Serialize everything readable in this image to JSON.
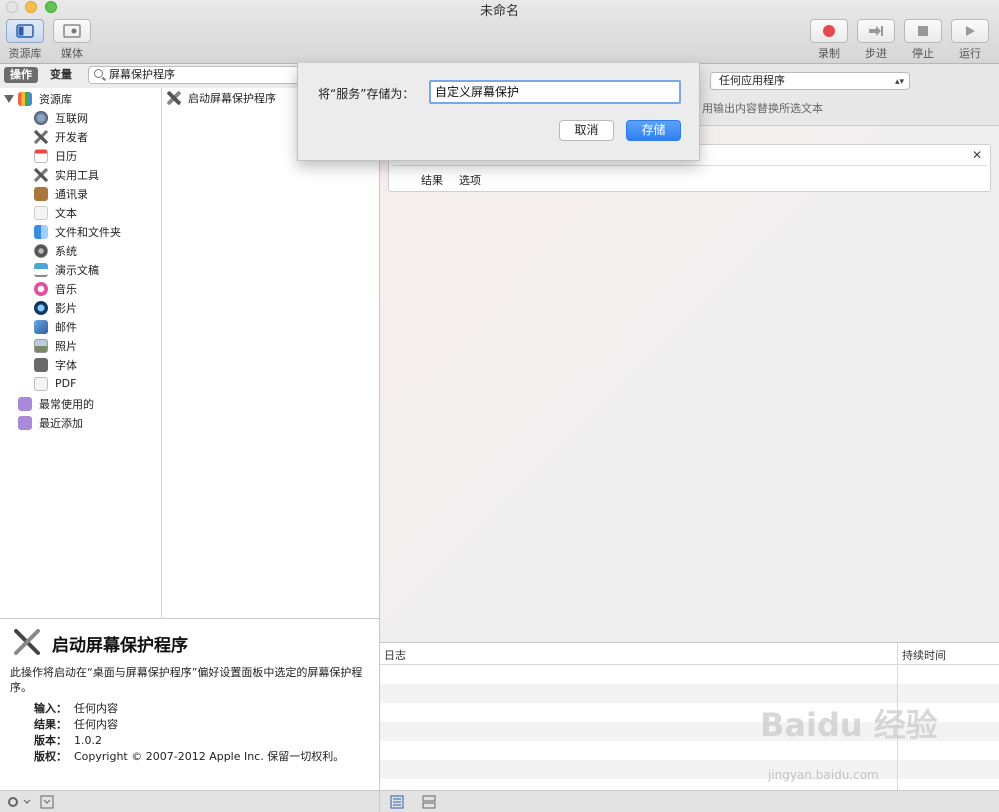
{
  "window": {
    "title": "未命名"
  },
  "toolbar": {
    "library": "资源库",
    "media": "媒体",
    "record": "录制",
    "step": "步进",
    "stop": "停止",
    "run": "运行"
  },
  "tabs": {
    "actions": "操作",
    "variables": "变量"
  },
  "search": {
    "value": "屏幕保护程序"
  },
  "library": {
    "root": "资源库",
    "items": [
      "互联网",
      "开发者",
      "日历",
      "实用工具",
      "通讯录",
      "文本",
      "文件和文件夹",
      "系统",
      "演示文稿",
      "音乐",
      "影片",
      "邮件",
      "照片",
      "字体",
      "PDF"
    ],
    "smart": [
      "最常使用的",
      "最近添加"
    ]
  },
  "actions_list": [
    "启动屏幕保护程序"
  ],
  "description": {
    "title": "启动屏幕保护程序",
    "text": "此操作将启动在“桌面与屏幕保护程序”偏好设置面板中选定的屏幕保护程序。",
    "input_key": "输入：",
    "input_val": "任何内容",
    "result_key": "结果：",
    "result_val": "任何内容",
    "version_key": "版本：",
    "version_val": "1.0.2",
    "copyright_key": "版权：",
    "copyright_val": "Copyright © 2007-2012 Apple Inc. 保留一切权利。"
  },
  "service": {
    "app_select": "任何应用程序",
    "replace_text": "用输出内容替换所选文本"
  },
  "card": {
    "tab_results": "结果",
    "tab_options": "选项"
  },
  "log": {
    "col_log": "日志",
    "col_duration": "持续时间"
  },
  "dialog": {
    "label": "将“服务”存储为：",
    "value": "自定义屏幕保护",
    "cancel": "取消",
    "save": "存储"
  },
  "watermark": {
    "text": "Baidu 经验",
    "sub": "jingyan.baidu.com"
  },
  "colors": {
    "accent": "#2d7ff3",
    "record": "#e5484d"
  }
}
